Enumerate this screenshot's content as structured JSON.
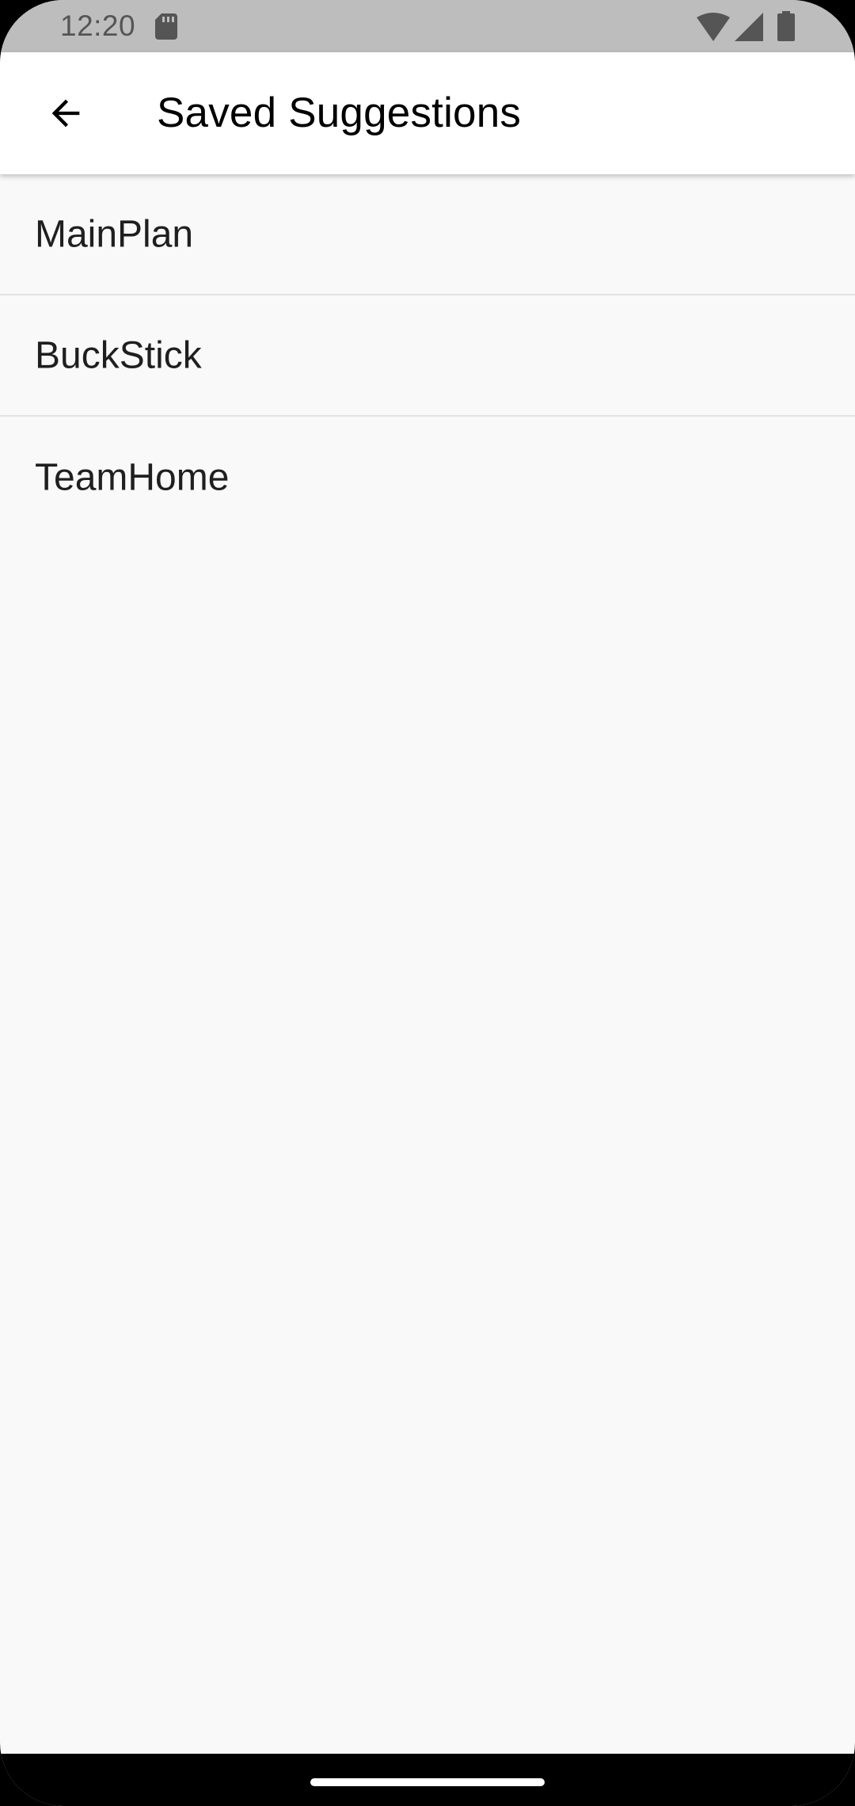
{
  "status_bar": {
    "time": "12:20",
    "icons": [
      "sd-card-icon",
      "wifi-icon",
      "cell-signal-icon",
      "battery-icon"
    ]
  },
  "app_bar": {
    "back_icon": "arrow-back-icon",
    "title": "Saved Suggestions"
  },
  "list": {
    "items": [
      {
        "label": "MainPlan"
      },
      {
        "label": "BuckStick"
      },
      {
        "label": "TeamHome"
      }
    ]
  },
  "colors": {
    "status_bar_bg": "#bdbdbd",
    "app_bar_bg": "#ffffff",
    "page_bg": "#f9f9f9",
    "divider": "#e2e2e2",
    "text": "#1f1f1f"
  }
}
